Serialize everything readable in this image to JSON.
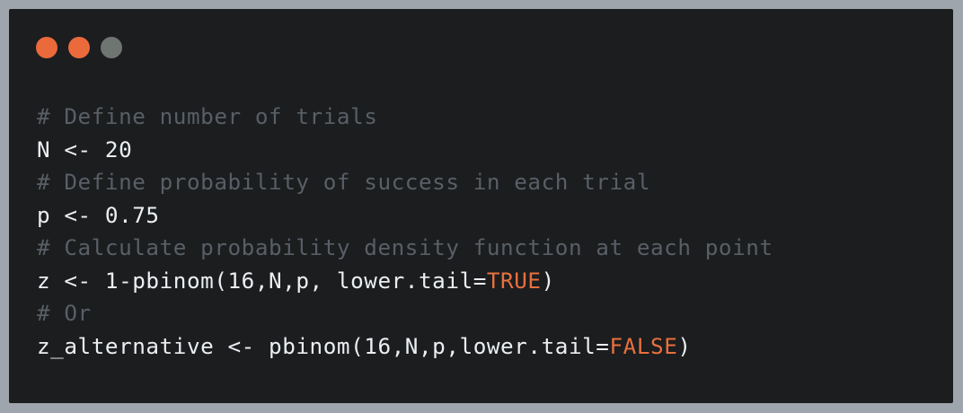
{
  "window": {
    "buttons": [
      {
        "name": "close",
        "color": "#ea6a3c"
      },
      {
        "name": "minimize",
        "color": "#ea6a3c"
      },
      {
        "name": "maximize",
        "color": "#6f7570"
      }
    ]
  },
  "colors": {
    "page_background": "#9fa5ad",
    "editor_background": "#1b1d1f",
    "comment": "#595f66",
    "text": "#eceff2",
    "constant": "#e8703e"
  },
  "code": {
    "line1_comment": "# Define number of trials",
    "line2_code": "N <- 20",
    "line3_comment": "# Define probability of success in each trial",
    "line4_code": "p <- 0.75",
    "line5_comment": "# Calculate probability density function at each point",
    "line6_code_a": "z <- 1-pbinom(16,N,p, lower.tail=",
    "line6_const": "TRUE",
    "line6_code_b": ")",
    "line7_comment": "# Or",
    "line8_code_a": "z_alternative <- pbinom(16,N,p,lower.tail=",
    "line8_const": "FALSE",
    "line8_code_b": ")"
  }
}
